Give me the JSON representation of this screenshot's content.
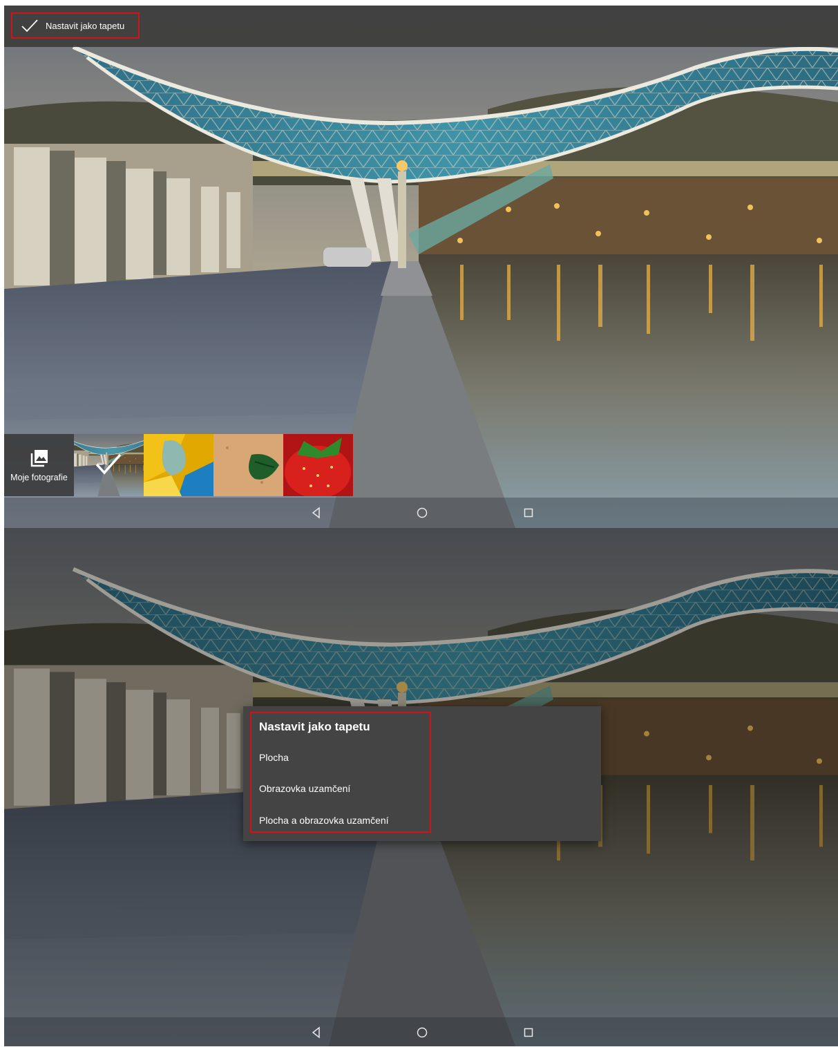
{
  "top_screen": {
    "action_bar": {
      "set_wallpaper_label": "Nastavit jako tapetu"
    },
    "picker": {
      "my_photos_label": "Moje fotografie",
      "thumbnails": [
        "bridge-wallpaper",
        "yellow-abstract",
        "green-leaf-on-sand",
        "strawberry"
      ],
      "selected_index": 0
    }
  },
  "bottom_screen": {
    "dialog": {
      "title": "Nastavit jako tapetu",
      "options": [
        "Plocha",
        "Obrazovka uzamčení",
        "Plocha a obrazovka uzamčení"
      ]
    }
  },
  "navbar": {
    "icons": [
      "back-icon",
      "home-icon",
      "recents-icon"
    ]
  },
  "colors": {
    "highlight": "#d0141a",
    "dialog_bg": "#444444",
    "topbar_bg": "#3a3a38"
  }
}
